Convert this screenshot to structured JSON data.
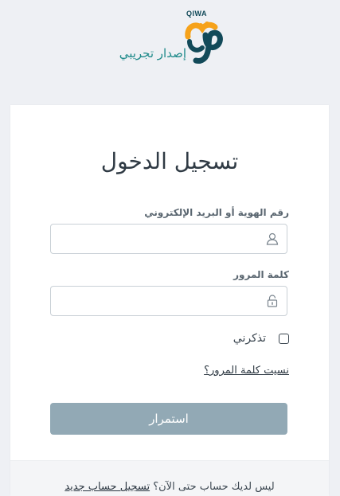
{
  "header": {
    "logo_text": "QIWA",
    "logo_subtitle": "إصدار تجريبي"
  },
  "login": {
    "title": "تسجيل الدخول",
    "id_label": "رقم الهوية أو البريد الإلكتروني",
    "id_value": "",
    "id_placeholder": "",
    "password_label": "كلمة المرور",
    "password_value": "",
    "password_placeholder": "",
    "remember_label": "تذكرني",
    "remember_checked": false,
    "forgot_link": "نسيت كلمة المرور؟",
    "submit_label": "استمرار"
  },
  "footer": {
    "question": "ليس لديك حساب حتى الآن؟",
    "register_link": "تسجيل حساب جديد"
  },
  "colors": {
    "brand_orange": "#f6a21a",
    "brand_teal": "#124a59",
    "subtitle_green": "#1e8a8a",
    "button_disabled": "#92a9b5",
    "background": "#eef0f4"
  },
  "icons": [
    "user-icon",
    "lock-icon"
  ]
}
